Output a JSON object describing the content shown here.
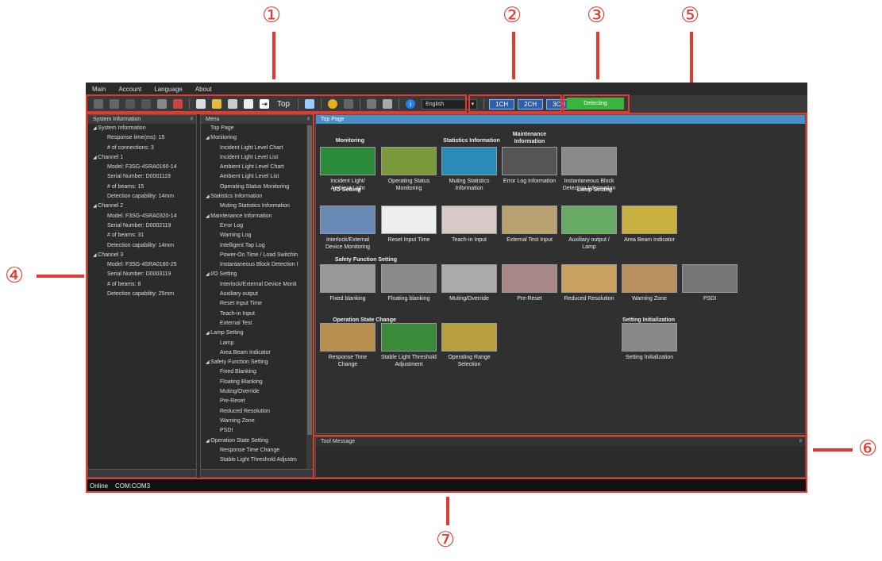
{
  "callouts": [
    "①",
    "②",
    "③",
    "⑤",
    "④",
    "⑥",
    "⑦"
  ],
  "menubar": [
    "Main",
    "Account",
    "Language",
    "About"
  ],
  "toolbar": {
    "top_label": "Top",
    "language": "English",
    "channels": [
      "1CH",
      "2CH",
      "3CH"
    ],
    "status": "Detecting"
  },
  "system_info": {
    "title": "System Information",
    "items": [
      {
        "t": "System Information",
        "l": 0
      },
      {
        "t": "Response time(ms): 15",
        "l": 1
      },
      {
        "t": "# of connections: 3",
        "l": 1
      },
      {
        "t": "Channel 1",
        "l": 0
      },
      {
        "t": "Model: F3SG-4SRA0160-14",
        "l": 1
      },
      {
        "t": "Serial Number: D0001119",
        "l": 1
      },
      {
        "t": "# of beams: 15",
        "l": 1
      },
      {
        "t": "Detection capability: 14mm",
        "l": 1
      },
      {
        "t": "Channel 2",
        "l": 0
      },
      {
        "t": "Model: F3SG-4SRA0320-14",
        "l": 1
      },
      {
        "t": "Serial Number: D0002119",
        "l": 1
      },
      {
        "t": "# of beams: 31",
        "l": 1
      },
      {
        "t": "Detection capability: 14mm",
        "l": 1
      },
      {
        "t": "Channel 3",
        "l": 0
      },
      {
        "t": "Model: F3SG-4SRA0160-25",
        "l": 1
      },
      {
        "t": "Serial Number: D0003119",
        "l": 1
      },
      {
        "t": "# of beams: 8",
        "l": 1
      },
      {
        "t": "Detection capability: 25mm",
        "l": 1
      }
    ]
  },
  "menu": {
    "title": "Menu",
    "items": [
      {
        "t": "Top Page",
        "l": 0
      },
      {
        "t": "Monitoring",
        "l": 0
      },
      {
        "t": "Incident Light Level Chart",
        "l": 1
      },
      {
        "t": "Incident Light Level List",
        "l": 1
      },
      {
        "t": "Ambient Light Level Chart",
        "l": 1
      },
      {
        "t": "Ambient Light Level List",
        "l": 1
      },
      {
        "t": "Operating Status Monitoring",
        "l": 1
      },
      {
        "t": "Statistics Information",
        "l": 0
      },
      {
        "t": "Muting Statistics Information",
        "l": 1
      },
      {
        "t": "Maintenance Information",
        "l": 0
      },
      {
        "t": "Error Log",
        "l": 1
      },
      {
        "t": "Warning Log",
        "l": 1
      },
      {
        "t": "Intelligent Tap Log",
        "l": 1
      },
      {
        "t": "Power-On Time / Load Switchin",
        "l": 1
      },
      {
        "t": "Instantaneous Block Detection I",
        "l": 1
      },
      {
        "t": "I/O Setting",
        "l": 0
      },
      {
        "t": "Interlock/External Device Monit",
        "l": 1
      },
      {
        "t": "Auxiliary output",
        "l": 1
      },
      {
        "t": "Reset Input Time",
        "l": 1
      },
      {
        "t": "Teach-in Input",
        "l": 1
      },
      {
        "t": "External Test",
        "l": 1
      },
      {
        "t": "Lamp Setting",
        "l": 0
      },
      {
        "t": "Lamp",
        "l": 1
      },
      {
        "t": "Area Beam Indicator",
        "l": 1
      },
      {
        "t": "Safety Function Setting",
        "l": 0
      },
      {
        "t": "Fixed Blanking",
        "l": 1
      },
      {
        "t": "Floating Blanking",
        "l": 1
      },
      {
        "t": "Muting/Override",
        "l": 1
      },
      {
        "t": "Pre-Reset",
        "l": 1
      },
      {
        "t": "Reduced Resolution",
        "l": 1
      },
      {
        "t": "Warning Zone",
        "l": 1
      },
      {
        "t": "PSDI",
        "l": 1
      },
      {
        "t": "Operation State Setting",
        "l": 0
      },
      {
        "t": "Response Time Change",
        "l": 1
      },
      {
        "t": "Stable Light Threshold Adjustm",
        "l": 1
      }
    ]
  },
  "top_page": {
    "title": "Top Page",
    "sections": [
      "Monitoring",
      "Statistics Information",
      "Maintenance Information",
      "I/O Setting",
      "Lamp Setting",
      "Safety Function Setting",
      "Operation State Change",
      "Setting Initialization"
    ],
    "tiles": [
      "Incident Light/ Ambient Light",
      "Operating Status Monitoring",
      "Muting Statistics Information",
      "Error Log Information",
      "Instantaneous Block Detection Information",
      "Interlock/External Device Monitoring",
      "Reset Input Time",
      "Teach-in Input",
      "External Test Input",
      "Auxiliary output / Lamp",
      "Area Beam Indicator",
      "Fixed blanking",
      "Floating blanking",
      "Muting/Override",
      "Pre-Reset",
      "Reduced Resolution",
      "Warning Zone",
      "PSDI",
      "Response Time Change",
      "Stable Light Threshold Adjustment",
      "Operating Range Selection",
      "Setting Initialization"
    ]
  },
  "tool_message": {
    "title": "Tool Message"
  },
  "status_bar": "Online    COM:COM3"
}
